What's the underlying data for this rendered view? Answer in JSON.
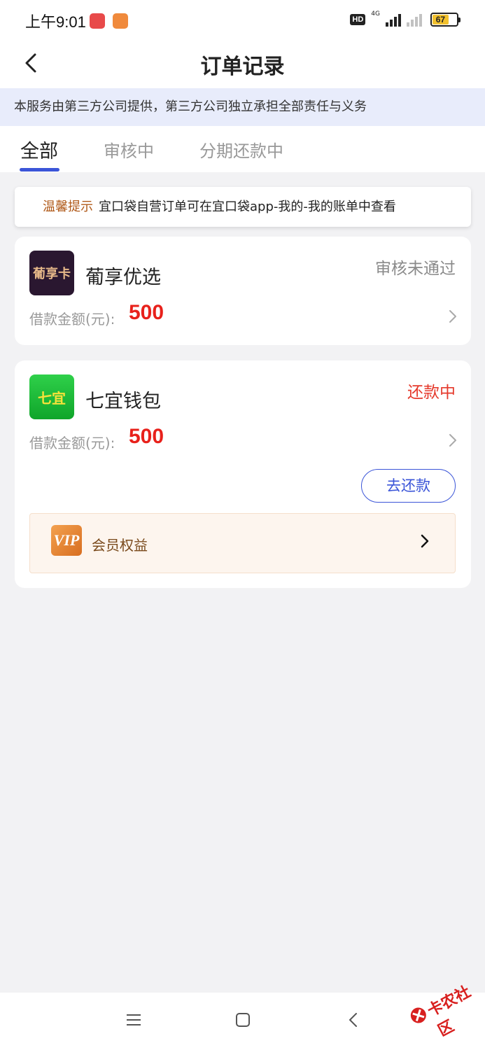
{
  "status_bar": {
    "time": "上午9:01",
    "hd": "HD",
    "network": "4G",
    "battery": "67",
    "battery_level": 0.67
  },
  "header": {
    "title": "订单记录"
  },
  "notice": "本服务由第三方公司提供，第三方公司独立承担全部责任与义务",
  "tabs": [
    {
      "label": "全部",
      "active": true
    },
    {
      "label": "审核中",
      "active": false
    },
    {
      "label": "分期还款中",
      "active": false
    }
  ],
  "tip": {
    "label": "温馨提示",
    "text": "宜口袋自营订单可在宜口袋app-我的-我的账单中查看"
  },
  "orders": [
    {
      "logo_text": "葡享卡",
      "name": "葡享优选",
      "status": "审核未通过",
      "amount_label": "借款金额(元):",
      "amount": "500"
    },
    {
      "logo_text": "七宜",
      "name": "七宜钱包",
      "status": "还款中",
      "amount_label": "借款金额(元):",
      "amount": "500",
      "action": "去还款",
      "vip_badge": "VIP",
      "vip_label": "会员权益"
    }
  ],
  "watermark": "卡农社区",
  "colors": {
    "accent": "#3b55d8",
    "amount": "#e8211b",
    "status_red": "#e53a2c",
    "status_gray": "#8a8a8a",
    "tip_label": "#b05a1a"
  }
}
